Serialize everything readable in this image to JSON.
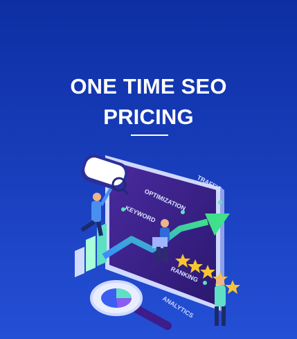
{
  "card": {
    "title_line1": "ONE TIME SEO",
    "title_line2": "PRICING"
  },
  "illustration": {
    "labels": {
      "traffic": "TRAFFIC",
      "optimization": "OPTIMIZATION",
      "keyword": "KEYWORD",
      "ranking": "RANKING",
      "analytics": "ANALYTICS"
    },
    "icons": [
      "search-icon",
      "magnifier-icon",
      "growth-arrow-icon",
      "star-icon",
      "laptop-icon",
      "pie-chart-icon"
    ],
    "stars_count": 5
  },
  "colors": {
    "background_top": "#0d2fa3",
    "background_bottom": "#2450d6",
    "monitor_screen": "#3a1f8a",
    "arrow": "#3fd27a",
    "star": "#f7c531",
    "accent": "#5ee0c4"
  }
}
